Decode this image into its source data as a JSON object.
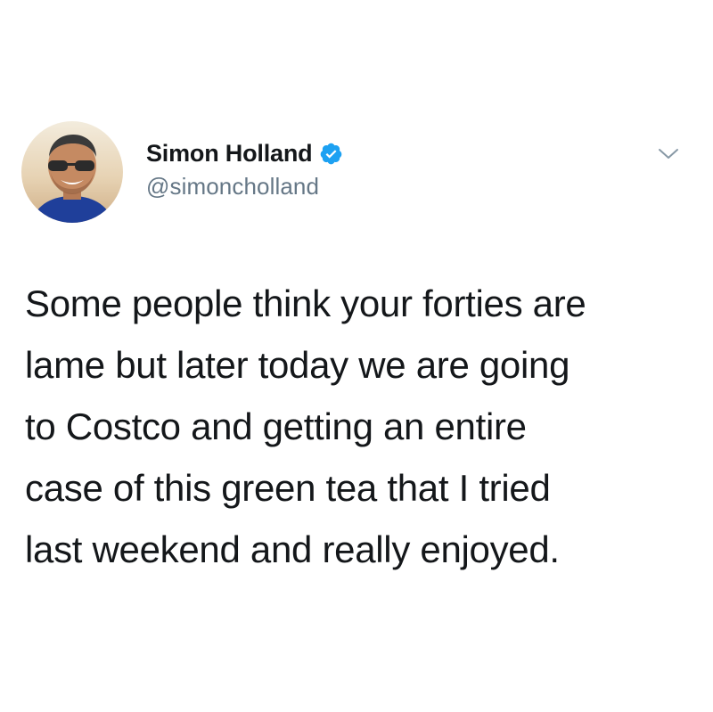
{
  "tweet": {
    "author": {
      "display_name": "Simon Holland",
      "handle": "@simoncholland",
      "verified": true,
      "verified_badge_color": "#1da1f2",
      "avatar_icon": "profile-photo"
    },
    "menu_icon": "chevron-down-icon",
    "text_lines": [
      "Some people think your forties are",
      "lame but later today we are going",
      "to Costco and getting an entire",
      "case of this green tea that I tried",
      "last weekend and really enjoyed."
    ]
  },
  "colors": {
    "background": "#ffffff",
    "text_primary": "#14171a",
    "text_secondary": "#657786",
    "accent": "#1da1f2"
  }
}
